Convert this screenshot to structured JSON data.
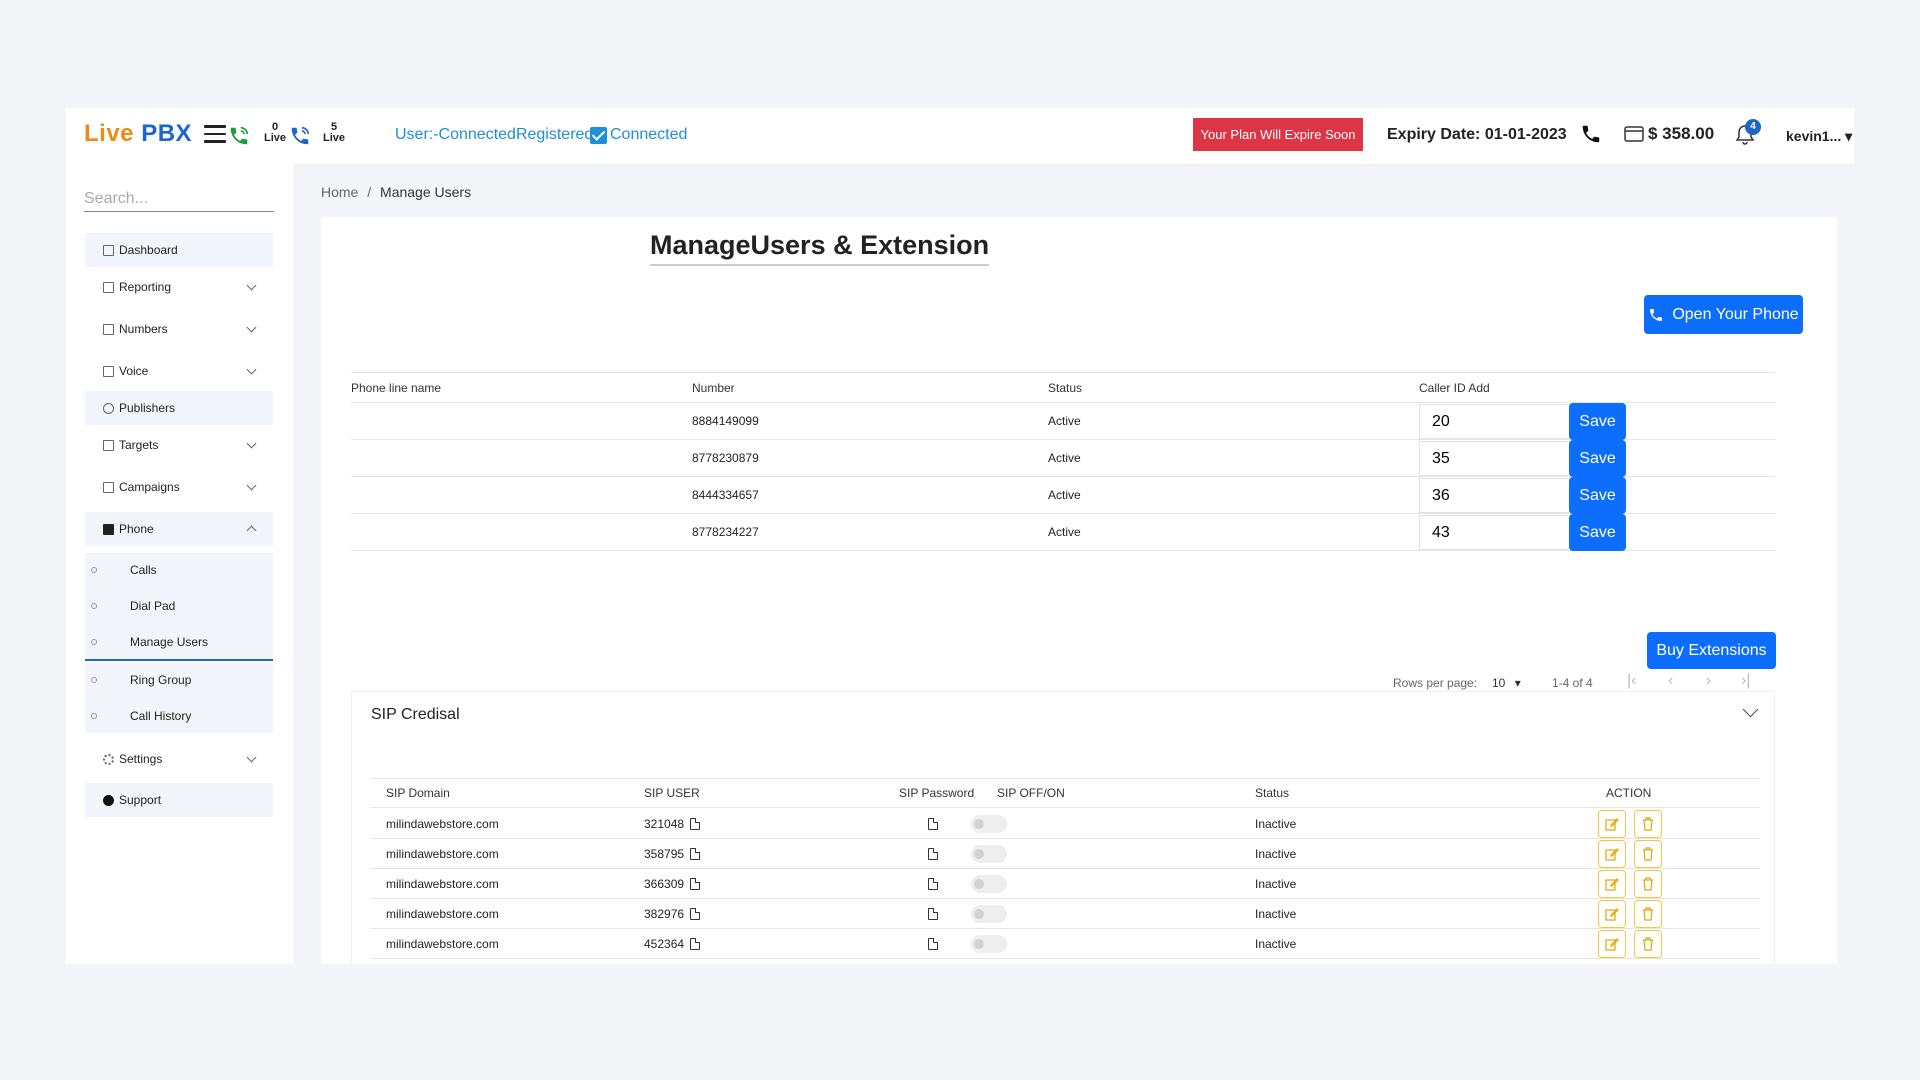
{
  "brand": {
    "live": "Live",
    "pbx": "PBX"
  },
  "topbar": {
    "live_left_count": "0",
    "live_left_label": "Live",
    "live_right_count": "5",
    "live_right_label": "Live",
    "user_status": "User:-ConnectedRegistered",
    "connected": "Connected",
    "plan_alert": "Your Plan Will Expire Soon",
    "expiry": "Expiry Date: 01-01-2023",
    "balance": "$ 358.00",
    "notifications": "4",
    "user": "kevin1..."
  },
  "sidebar": {
    "search_placeholder": "Search...",
    "items": [
      {
        "label": "Dashboard"
      },
      {
        "label": "Reporting"
      },
      {
        "label": "Numbers"
      },
      {
        "label": "Voice"
      },
      {
        "label": "Publishers"
      },
      {
        "label": "Targets"
      },
      {
        "label": "Campaigns"
      },
      {
        "label": "Phone"
      },
      {
        "label": "Settings"
      },
      {
        "label": "Support"
      }
    ],
    "phone_sub": [
      {
        "label": "Calls"
      },
      {
        "label": "Dial Pad"
      },
      {
        "label": "Manage Users"
      },
      {
        "label": "Ring Group"
      },
      {
        "label": "Call History"
      }
    ]
  },
  "breadcrumb": {
    "home": "Home",
    "sep": "/",
    "current": "Manage Users"
  },
  "page": {
    "title": "ManageUsers & Extension",
    "open_phone": "Open Your Phone",
    "buy_extensions": "Buy Extensions"
  },
  "numbers_table": {
    "headers": [
      "Phone line name",
      "Number",
      "Status",
      "Caller ID Add"
    ],
    "save_label": "Save",
    "rows": [
      {
        "name": "",
        "number": "8884149099",
        "status": "Active",
        "caller_id": "20"
      },
      {
        "name": "",
        "number": "8778230879",
        "status": "Active",
        "caller_id": "35"
      },
      {
        "name": "",
        "number": "8444334657",
        "status": "Active",
        "caller_id": "36"
      },
      {
        "name": "",
        "number": "8778234227",
        "status": "Active",
        "caller_id": "43"
      }
    ]
  },
  "pagination": {
    "rows_per_page_label": "Rows per page:",
    "rows_per_page": "10",
    "range": "1-4 of 4"
  },
  "sip": {
    "title": "SIP Credisal",
    "headers": [
      "SIP Domain",
      "SIP USER",
      "SIP Password",
      "SIP OFF/ON",
      "Status",
      "ACTION"
    ],
    "rows": [
      {
        "domain": "milindawebstore.com",
        "user": "321048",
        "status": "Inactive"
      },
      {
        "domain": "milindawebstore.com",
        "user": "358795",
        "status": "Inactive"
      },
      {
        "domain": "milindawebstore.com",
        "user": "366309",
        "status": "Inactive"
      },
      {
        "domain": "milindawebstore.com",
        "user": "382976",
        "status": "Inactive"
      },
      {
        "domain": "milindawebstore.com",
        "user": "452364",
        "status": "Inactive"
      }
    ]
  },
  "colors": {
    "brand_orange": "#f08a12",
    "brand_blue": "#1b66c9",
    "primary": "#0d6efd",
    "alert": "#dc3545",
    "status_link": "#1f8fd6",
    "action_border": "#f5c542"
  }
}
